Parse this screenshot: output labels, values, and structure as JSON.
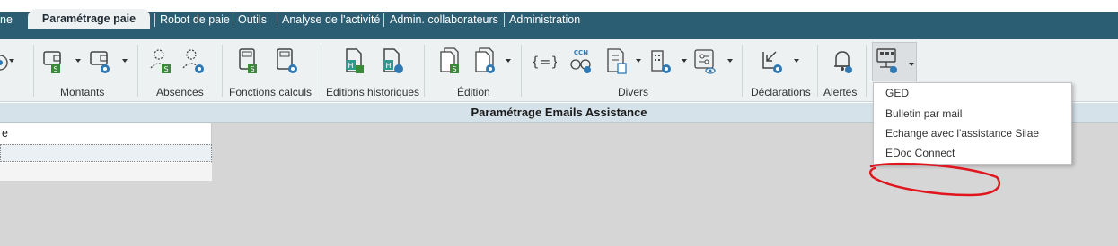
{
  "menubar": {
    "partial_first": "ne",
    "active_tab": "Paramétrage paie",
    "items": [
      "Robot de paie",
      "Outils",
      "Analyse de l'activité",
      "Admin. collaborateurs",
      "Administration"
    ]
  },
  "ribbon": {
    "groups": [
      "Montants",
      "Absences",
      "Fonctions calculs",
      "Editions historiques",
      "Édition",
      "Divers",
      "Déclarations",
      "Alertes"
    ],
    "badges": {
      "s": "S",
      "h": "H",
      "ccn": "CCN",
      "braces": "{=}"
    }
  },
  "panel": {
    "title": "Paramétrage Emails Assistance"
  },
  "list": {
    "row1": "e",
    "row2": "",
    "row3": ""
  },
  "dropdown": {
    "items": [
      "GED",
      "Bulletin par mail",
      "Echange avec l'assistance Silae",
      "EDoc Connect"
    ]
  },
  "colors": {
    "menubar": "#2b5d73",
    "ribbon": "#eef1f2",
    "badge_green": "#3a8a3a",
    "gear_blue": "#2f79b5",
    "annotation": "#e0161e",
    "workspace": "#d6d6d6"
  }
}
